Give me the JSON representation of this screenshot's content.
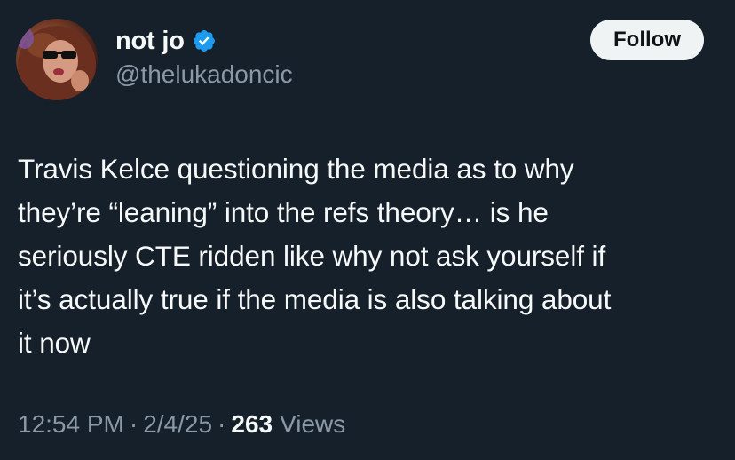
{
  "author": {
    "display_name": "not jo",
    "handle": "@thelukadoncic",
    "verified": true,
    "verified_icon": "verified-badge-icon",
    "verified_color": "#1d9bf0"
  },
  "follow_button": {
    "label": "Follow"
  },
  "tweet": {
    "text": "Travis Kelce questioning the media as to why\nthey’re “leaning” into the refs theory… is he\nseriously CTE ridden like why not ask yourself if\nit’s actually true if the media is also talking about\nit now"
  },
  "meta": {
    "time": "12:54 PM",
    "separator": "·",
    "date": "2/4/25",
    "views_count": "263",
    "views_label": "Views"
  },
  "colors": {
    "background": "#15202b",
    "text_primary": "#f7f9f9",
    "text_secondary": "#8b98a5",
    "button_bg": "#eff3f4"
  }
}
